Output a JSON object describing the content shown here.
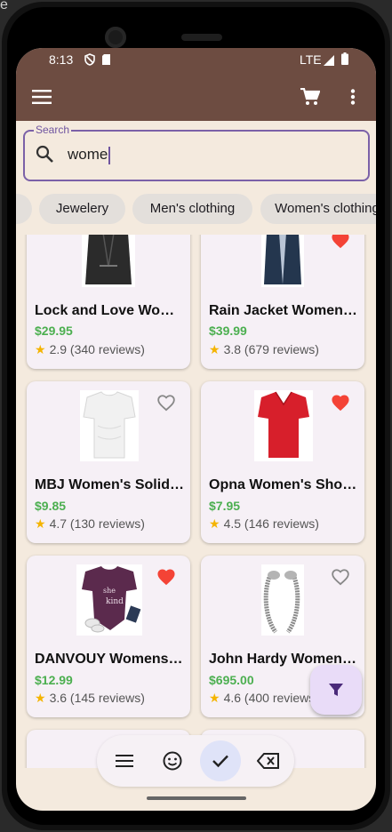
{
  "device": {
    "overflow_label": "e"
  },
  "status_bar": {
    "time": "8:13",
    "network": "LTE"
  },
  "app_bar": {
    "menu_icon": "menu-icon",
    "cart_icon": "shopping-cart-icon",
    "more_icon": "more-vert-icon"
  },
  "search": {
    "label": "Search",
    "value": "wome",
    "icon": "search-icon"
  },
  "categories": [
    "Jewelery",
    "Men's clothing",
    "Women's clothing"
  ],
  "products": [
    {
      "title": "Lock and Love Women's Removable Hooded Faux Leather Moto Biker Jacket",
      "price": "$29.95",
      "rating": "2.9",
      "reviews": "(340 reviews)",
      "favorite": false
    },
    {
      "title": "Rain Jacket Women Windbreaker Striped Climbing Raincoats",
      "price": "$39.99",
      "rating": "3.8",
      "reviews": "(679 reviews)",
      "favorite": true
    },
    {
      "title": "MBJ Women's Solid Short Sleeve Boat Neck V",
      "price": "$9.85",
      "rating": "4.7",
      "reviews": "(130 reviews)",
      "favorite": false
    },
    {
      "title": "Opna Women's Short Sleeve Moisture",
      "price": "$7.95",
      "rating": "4.5",
      "reviews": "(146 reviews)",
      "favorite": true
    },
    {
      "title": "DANVOUY Womens T Shirt Casual Cotton Short",
      "price": "$12.99",
      "rating": "3.6",
      "reviews": "(145 reviews)",
      "favorite": true
    },
    {
      "title": "John Hardy Women's Legends Naga Gold & Silver Dragon Station Chain Bracelet",
      "price": "$695.00",
      "rating": "4.6",
      "reviews": "(400 reviews)",
      "favorite": false
    }
  ],
  "fab": {
    "icon": "filter-icon"
  },
  "bottom_bar": {
    "icons": [
      "menu-icon",
      "emoji-icon",
      "check-icon",
      "backspace-icon"
    ],
    "selected": "check-icon"
  },
  "colors": {
    "app_bar": "#6d4c41",
    "background": "#f4eade",
    "price": "#4caf50",
    "favorite": "#f44336",
    "accent": "#7b61a8"
  }
}
